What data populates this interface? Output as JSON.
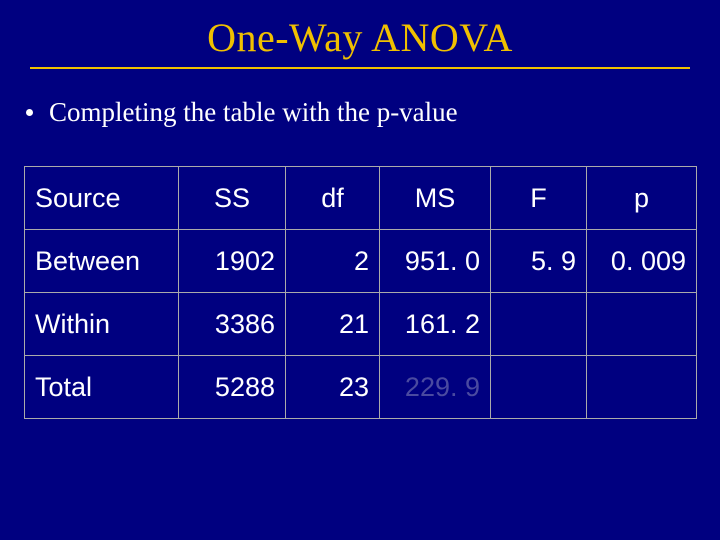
{
  "title": "One-Way ANOVA",
  "bullet": "Completing the table with the p-value",
  "headers": {
    "source": "Source",
    "ss": "SS",
    "df": "df",
    "ms": "MS",
    "f": "F",
    "p": "p"
  },
  "rows": {
    "between": {
      "label": "Between",
      "ss": "1902",
      "df": "2",
      "ms": "951. 0",
      "f": "5. 9",
      "p": "0. 009"
    },
    "within": {
      "label": "Within",
      "ss": "3386",
      "df": "21",
      "ms": "161. 2"
    },
    "total": {
      "label": "Total",
      "ss": "5288",
      "df": "23",
      "ms": "229. 9"
    }
  },
  "chart_data": {
    "type": "table",
    "title": "One-Way ANOVA",
    "columns": [
      "Source",
      "SS",
      "df",
      "MS",
      "F",
      "p"
    ],
    "rows": [
      [
        "Between",
        1902,
        2,
        951.0,
        5.9,
        0.009
      ],
      [
        "Within",
        3386,
        21,
        161.2,
        null,
        null
      ],
      [
        "Total",
        5288,
        23,
        229.9,
        null,
        null
      ]
    ]
  }
}
